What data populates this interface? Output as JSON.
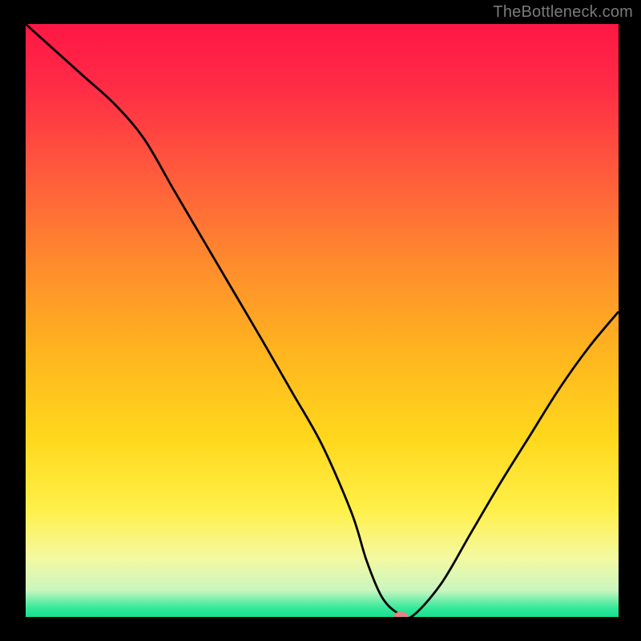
{
  "attribution": "TheBottleneck.com",
  "colors": {
    "background": "#000000",
    "curve": "#000000",
    "marker": "#e0857f",
    "gradient_stops": [
      {
        "offset": 0.0,
        "color": "#ff1744"
      },
      {
        "offset": 0.1,
        "color": "#ff2a46"
      },
      {
        "offset": 0.25,
        "color": "#ff5a3c"
      },
      {
        "offset": 0.4,
        "color": "#ff8a2e"
      },
      {
        "offset": 0.55,
        "color": "#ffb41f"
      },
      {
        "offset": 0.7,
        "color": "#ffd81c"
      },
      {
        "offset": 0.82,
        "color": "#fff04a"
      },
      {
        "offset": 0.9,
        "color": "#f4f9a0"
      },
      {
        "offset": 0.955,
        "color": "#c9f6c0"
      },
      {
        "offset": 0.985,
        "color": "#34e89a"
      },
      {
        "offset": 1.0,
        "color": "#14e08f"
      }
    ]
  },
  "chart_data": {
    "type": "line",
    "title": "",
    "xlabel": "",
    "ylabel": "",
    "xlim": [
      0,
      1
    ],
    "ylim": [
      0,
      1
    ],
    "x": [
      0.0,
      0.05,
      0.1,
      0.15,
      0.2,
      0.25,
      0.3,
      0.35,
      0.4,
      0.45,
      0.5,
      0.55,
      0.575,
      0.6,
      0.625,
      0.65,
      0.7,
      0.75,
      0.8,
      0.85,
      0.9,
      0.95,
      1.0
    ],
    "values": [
      1.0,
      0.955,
      0.91,
      0.865,
      0.806,
      0.72,
      0.635,
      0.55,
      0.465,
      0.378,
      0.29,
      0.175,
      0.095,
      0.035,
      0.008,
      0.0,
      0.055,
      0.14,
      0.225,
      0.305,
      0.385,
      0.455,
      0.515
    ],
    "series": [
      {
        "name": "bottleneck-curve",
        "values": "inline-above"
      }
    ],
    "marker": {
      "x": 0.633,
      "y": 0.0,
      "rx": 0.013,
      "ry": 0.009
    }
  }
}
